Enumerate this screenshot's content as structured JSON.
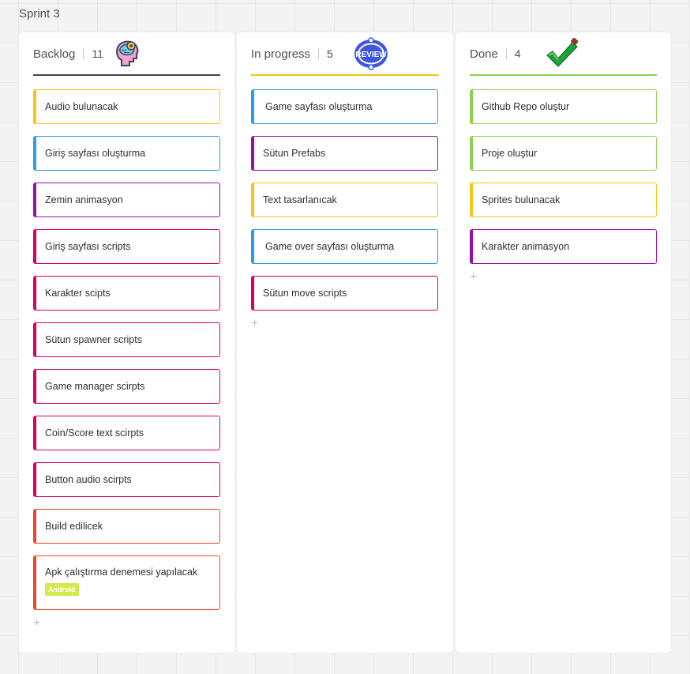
{
  "frame": {
    "title": "Sprint 3"
  },
  "columns": [
    {
      "title": "Backlog",
      "count": "11",
      "icon": "brain-head-sticker-icon",
      "cards": [
        {
          "text": "Audio bulunacak",
          "color": "#f5c518"
        },
        {
          "text": "Giriş sayfası oluşturma",
          "color": "#2d9bf0"
        },
        {
          "text": "Zemin animasyon",
          "color": "#9510ac"
        },
        {
          "text": "Giriş sayfası scripts",
          "color": "#da0063"
        },
        {
          "text": "Karakter scipts",
          "color": "#da0063"
        },
        {
          "text": "Sütun spawner scripts",
          "color": "#da0063"
        },
        {
          "text": "Game manager scirpts",
          "color": "#da0063"
        },
        {
          "text": "Coin/Score text scirpts",
          "color": "#da0063"
        },
        {
          "text": "Button audio scirpts",
          "color": "#da0063"
        },
        {
          "text": "Build edilicek",
          "color": "#f24726"
        },
        {
          "text": "Apk çalıştırma denemesi yapılacak",
          "color": "#f24726",
          "tag": "Android"
        }
      ],
      "add_label": "+"
    },
    {
      "title": "In progress",
      "count": "5",
      "icon": "review-badge-icon",
      "icon_text": "REVIEW",
      "cards": [
        {
          "text": "Game sayfası oluşturma",
          "color": "#2d9bf0"
        },
        {
          "text": "Sütun Prefabs",
          "color": "#9510ac"
        },
        {
          "text": "Text tasarlanıcak",
          "color": "#f5c518"
        },
        {
          "text": "Game over sayfası oluşturma",
          "color": "#2d9bf0"
        },
        {
          "text": "Sütun move scripts",
          "color": "#da0063"
        }
      ],
      "add_label": "+"
    },
    {
      "title": "Done",
      "count": "4",
      "icon": "checkmark-icon",
      "cards": [
        {
          "text": "Github Repo oluştur",
          "color": "#8fd14f"
        },
        {
          "text": "Proje oluştur",
          "color": "#8fd14f"
        },
        {
          "text": "Sprites bulunacak",
          "color": "#f5c518"
        },
        {
          "text": "Karakter animasyon",
          "color": "#9510ac"
        }
      ],
      "add_label": "+"
    }
  ]
}
